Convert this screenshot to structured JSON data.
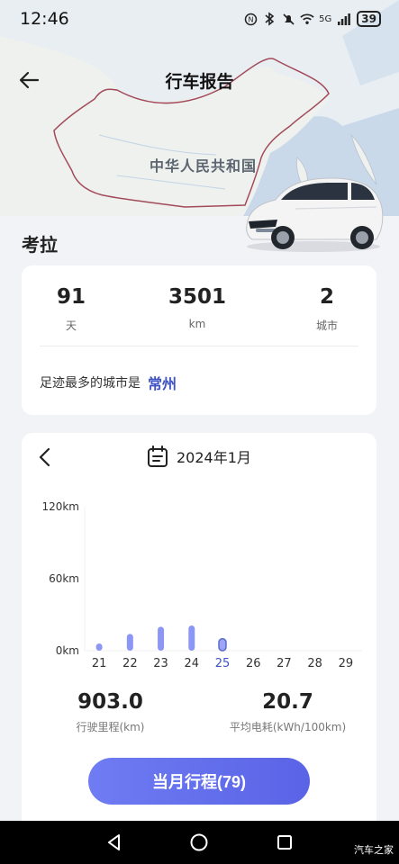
{
  "status_bar": {
    "time": "12:46",
    "network": "5G",
    "battery": "39"
  },
  "header": {
    "title": "行车报告"
  },
  "map": {
    "label": "中华人民共和国"
  },
  "owner": {
    "name": "考拉"
  },
  "stats": [
    {
      "value": "91",
      "unit": "天"
    },
    {
      "value": "3501",
      "unit": "km"
    },
    {
      "value": "2",
      "unit": "城市"
    }
  ],
  "city": {
    "prefix": "足迹最多的城市是",
    "name": "常州"
  },
  "month": {
    "label": "2024年1月"
  },
  "chart_data": {
    "type": "bar",
    "categories": [
      "21",
      "22",
      "23",
      "24",
      "25",
      "26",
      "27",
      "28",
      "29"
    ],
    "values": [
      6,
      14,
      20,
      21,
      10,
      0,
      0,
      0,
      0
    ],
    "selected": "25",
    "ylim": [
      0,
      120
    ],
    "yticks": [
      "0km",
      "60km",
      "120km"
    ],
    "ytick_values": [
      0,
      60,
      120
    ],
    "bar_color": "#6f7cf2",
    "selected_color": "#3f53c2"
  },
  "summary": [
    {
      "value": "903.0",
      "label": "行驶里程(km)"
    },
    {
      "value": "20.7",
      "label": "平均电耗(kWh/100km)"
    }
  ],
  "trip_button": {
    "label": "当月行程(79)"
  },
  "watermark": "汽车之家"
}
